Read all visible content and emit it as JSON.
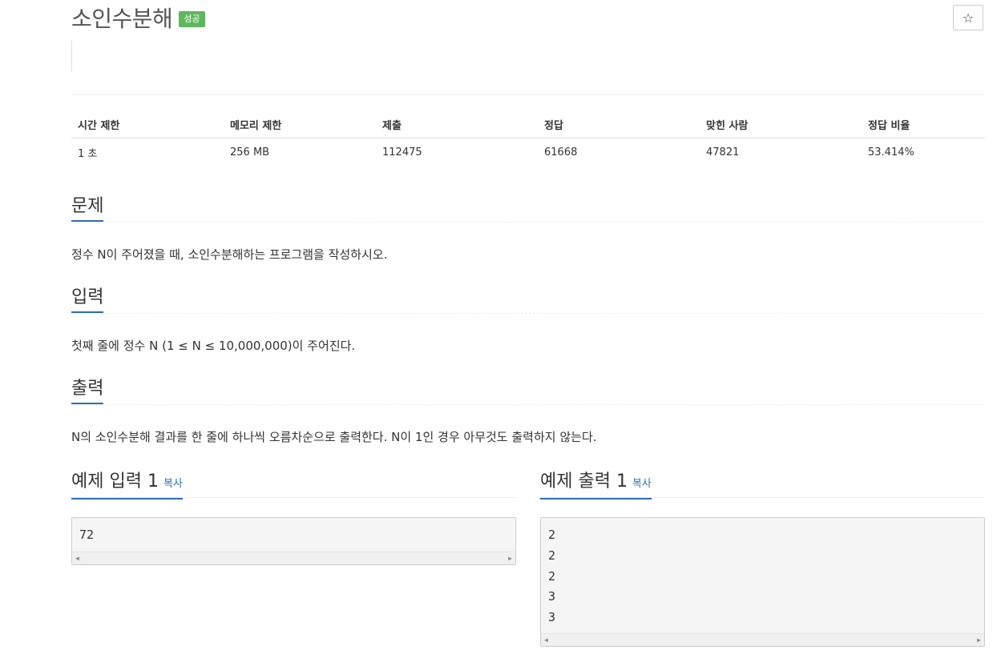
{
  "problem": {
    "title": "소인수분해",
    "badge": "성공",
    "star": "☆"
  },
  "info": {
    "headers": [
      "시간 제한",
      "메모리 제한",
      "제출",
      "정답",
      "맞힌 사람",
      "정답 비율"
    ],
    "values": [
      "1 초",
      "256 MB",
      "112475",
      "61668",
      "47821",
      "53.414%"
    ]
  },
  "sections": {
    "description": {
      "heading": "문제",
      "text": "정수 N이 주어졌을 때, 소인수분해하는 프로그램을 작성하시오."
    },
    "input": {
      "heading": "입력",
      "text": "첫째 줄에 정수 N (1 ≤ N ≤ 10,000,000)이 주어진다."
    },
    "output": {
      "heading": "출력",
      "text": "N의 소인수분해 결과를 한 줄에 하나씩 오름차순으로 출력한다. N이 1인 경우 아무것도 출력하지 않는다."
    }
  },
  "samples": {
    "input": {
      "heading": "예제 입력 1",
      "copy": "복사",
      "lines": [
        "72"
      ]
    },
    "output": {
      "heading": "예제 출력 1",
      "copy": "복사",
      "lines": [
        "2",
        "2",
        "2",
        "3",
        "3"
      ]
    }
  },
  "icons": {
    "scroll_left": "scroll-left-icon",
    "scroll_right": "scroll-right-icon",
    "star": "star-icon"
  },
  "colors": {
    "accent": "#2f6fb0",
    "success": "#5cb85c"
  }
}
